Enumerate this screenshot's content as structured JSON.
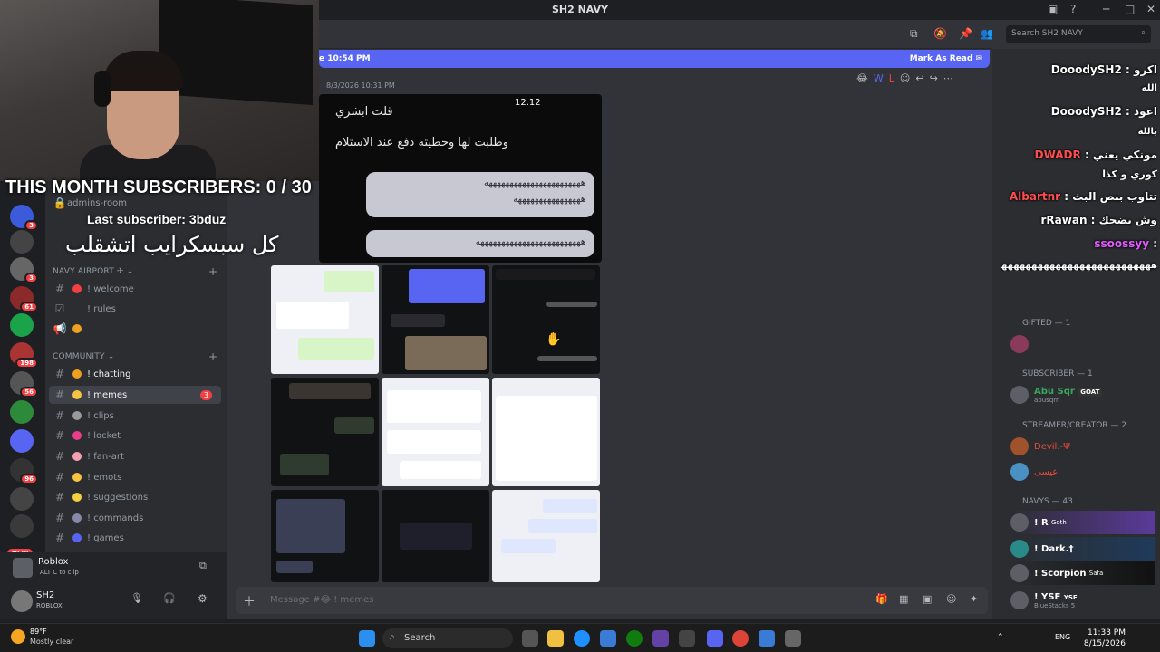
{
  "window": {
    "title": "SH2 NAVY"
  },
  "overlay": {
    "subs_text": "THIS MONTH SUBSCRIBERS: 0 / 30",
    "last_sub": "Last subscriber: 3bduz",
    "arabic_line": "كل سبسكرايب اتشقلب"
  },
  "sidebar": {
    "partial_channels": [
      "admins-room"
    ],
    "navy_airport": {
      "title": "NAVY AIRPORT ✈",
      "channels": [
        {
          "label": "welcome",
          "prefix": "!"
        },
        {
          "label": "rules",
          "prefix": "!"
        }
      ]
    },
    "community": {
      "title": "COMMUNITY",
      "channels": [
        {
          "label": "chatting",
          "prefix": "!"
        },
        {
          "label": "memes",
          "prefix": "!",
          "mentions": "3"
        },
        {
          "label": "clips",
          "prefix": "!"
        },
        {
          "label": "locket",
          "prefix": "!"
        },
        {
          "label": "fan-art",
          "prefix": "!"
        },
        {
          "label": "emots",
          "prefix": "!"
        },
        {
          "label": "suggestions",
          "prefix": "!"
        },
        {
          "label": "commands",
          "prefix": "!"
        },
        {
          "label": "games",
          "prefix": "!"
        }
      ]
    },
    "server_badges": [
      "3",
      "3",
      "61",
      "198",
      "56",
      "96",
      "NEW"
    ]
  },
  "activity": {
    "game": "Roblox",
    "hint_keys": "ALT  C",
    "hint_text": "to clip"
  },
  "user": {
    "name": "SH2",
    "status": "ROBLOX"
  },
  "chat": {
    "new_messages_since": "e 10:54 PM",
    "mark_as_read": "Mark As Read",
    "message_time": "8/3/2026 10:31 PM",
    "composer_placeholder": "Message #😂 ! memes",
    "image_texts": {
      "line1": "قلت ابشري",
      "line2": "وطلبت لها وحطيته دفع عند الاستلام",
      "line3": "هههههههههههههههههههههههه",
      "line4": "ههههههههههههههههه",
      "line5": "هههههههههههههههههههههههههه",
      "clock": "12.12"
    }
  },
  "members_panel": {
    "search_placeholder": "Search SH2 NAVY",
    "gifted": "GIFTED — 1",
    "subscriber": "SUBSCRIBER — 1",
    "streamer": "STREAMER/CREATOR — 2",
    "navys": "NAVYs — 43",
    "members": [
      {
        "name": "Abu Sqr",
        "tag": "GOAT",
        "sub": "abusqrr"
      },
      {
        "name": "Devil.-Ψ",
        "tag": "",
        "sub": ""
      },
      {
        "name": "عيسى",
        "tag": "",
        "sub": ""
      },
      {
        "name": "! R",
        "tag": "Goth",
        "sub": ""
      },
      {
        "name": "! Dark.†",
        "tag": "",
        "sub": ""
      },
      {
        "name": "! Scorpion",
        "tag": "Safa",
        "sub": ""
      },
      {
        "name": "! YSF",
        "tag": "YSF",
        "sub": "BlueStacks 5"
      }
    ]
  },
  "stream_chat": [
    {
      "user": "DooodySH2",
      "msg": "اكرو",
      "color": "#ffffff"
    },
    {
      "user": "",
      "msg": "الله",
      "color": "#ffffff"
    },
    {
      "user": "DooodySH2",
      "msg": "اعوذ",
      "color": "#ffffff"
    },
    {
      "user": "",
      "msg": "بالله",
      "color": "#ffffff"
    },
    {
      "user": "DWADR",
      "msg": "مونكي يعني",
      "color": "#ff4d4d"
    },
    {
      "user": "",
      "msg": "كوري و كذا",
      "color": "#ffffff"
    },
    {
      "user": "Albartnr",
      "msg": "تتاوب بنص البث",
      "color": "#ff4d4d"
    },
    {
      "user": "rRawan",
      "msg": "وش يضحك",
      "color": "#ffffff"
    },
    {
      "user": "ssoossyy",
      "msg": "",
      "color": "#e05cff"
    },
    {
      "user": "",
      "msg": "ههههههههههههههههههههههههههههه",
      "color": "#ffffff"
    }
  ],
  "taskbar": {
    "weather_temp": "89°F",
    "weather_desc": "Mostly clear",
    "search": "Search",
    "lang": "ENG",
    "time": "11:33 PM",
    "date": "8/15/2026"
  },
  "colors": {
    "accent": "#5865f2",
    "mention": "#f23f43",
    "bg": "#313338"
  }
}
